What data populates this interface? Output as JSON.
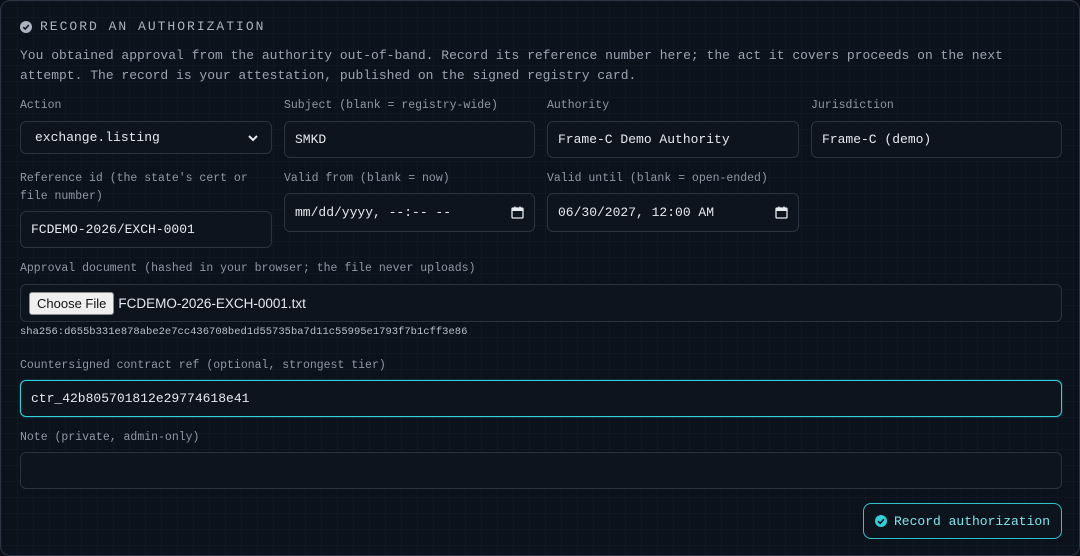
{
  "header": {
    "title": "RECORD AN AUTHORIZATION",
    "icon": "check-circle-icon",
    "description": "You obtained approval from the authority out-of-band. Record its reference number here; the act it covers proceeds on the next attempt. The record is your attestation, published on the signed registry card."
  },
  "fields": {
    "action": {
      "label": "Action",
      "value": "exchange.listing"
    },
    "subject": {
      "label": "Subject (blank = registry-wide)",
      "value": "SMKD"
    },
    "authority": {
      "label": "Authority",
      "value": "Frame-C Demo Authority"
    },
    "jurisdiction": {
      "label": "Jurisdiction",
      "value": "Frame-C (demo)"
    },
    "reference": {
      "label": "Reference id (the state's cert or file number)",
      "value": "FCDEMO-2026/EXCH-0001"
    },
    "valid_from": {
      "label": "Valid from (blank = now)",
      "placeholder": "mm/dd/yyyy, --:-- --"
    },
    "valid_until": {
      "label": "Valid until (blank = open-ended)",
      "value": "06/30/2027, 12:00 AM"
    },
    "approval": {
      "label": "Approval document (hashed in your browser; the file never uploads)",
      "button_label": "Choose File",
      "file_name": "FCDEMO-2026-EXCH-0001.txt",
      "hash": "sha256:d655b331e878abe2e7cc436708bed1d55735ba7d11c55995e1793f7b1cff3e86"
    },
    "contract": {
      "label": "Countersigned contract ref (optional, strongest tier)",
      "value": "ctr_42b805701812e29774618e41"
    },
    "note": {
      "label": "Note (private, admin-only)",
      "value": ""
    }
  },
  "actions": {
    "submit_label": "Record authorization",
    "submit_icon": "check-circle-icon"
  },
  "colors": {
    "accent": "#2fd0d8",
    "background": "#0c121c",
    "border": "#2a3340"
  }
}
